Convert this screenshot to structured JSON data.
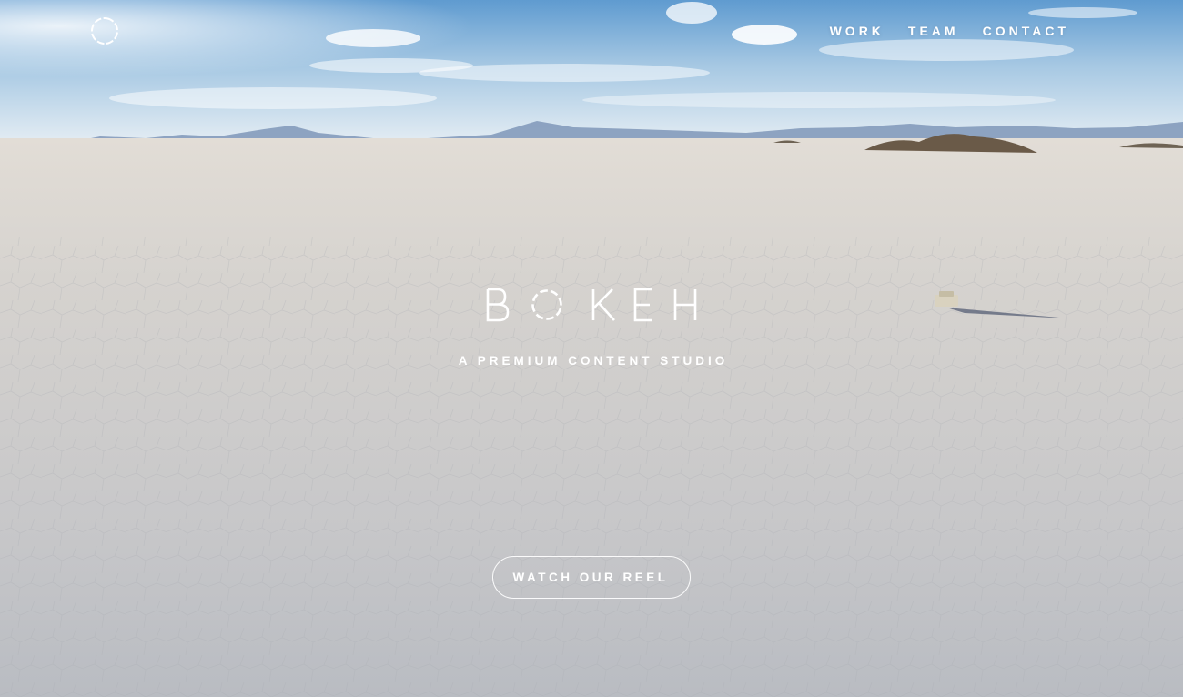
{
  "brand": {
    "logo_icon": "ring-logo-icon",
    "wordmark": "BOKEH",
    "tagline": "A PREMIUM CONTENT STUDIO"
  },
  "nav": {
    "items": [
      {
        "label": "WORK"
      },
      {
        "label": "TEAM"
      },
      {
        "label": "CONTACT"
      }
    ]
  },
  "hero": {
    "cta_label": "WATCH OUR REEL",
    "background": "salt-flat-landscape-image"
  },
  "colors": {
    "text": "#ffffff",
    "sky_top": "#6fa6d6",
    "horizon": "#e8eef3",
    "ground": "#c9c8c6"
  }
}
